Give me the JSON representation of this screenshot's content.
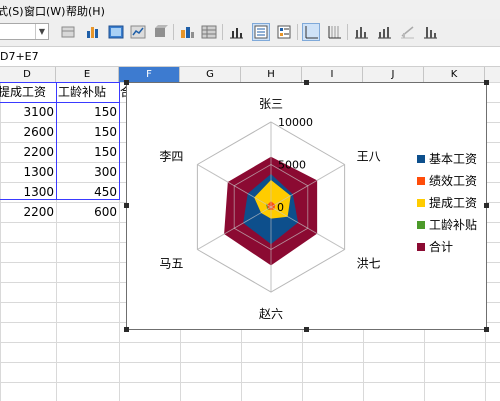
{
  "menu": {
    "items": [
      "式(S)",
      "窗口(W)",
      "帮助(H)"
    ]
  },
  "toolbar": {
    "namebox_value": "",
    "icons": [
      "table-icon",
      "bar-chart-icon",
      "chart-wall-icon",
      "chart-area-icon",
      "3d-view-icon",
      "chart-type-icon",
      "data-table-icon",
      "x-axis-grid-icon",
      "legend-on-off-icon",
      "legend-icon",
      "horizontal-grid-icon",
      "vertical-grid-icon",
      "bar-chart-small-icon",
      "bar-chart-alt-icon",
      "trend-icon",
      "column-chart-icon"
    ]
  },
  "formula_bar": {
    "text": "D7+E7"
  },
  "columns": [
    "D",
    "E",
    "F",
    "G",
    "H",
    "I",
    "J",
    "K"
  ],
  "selected_column": "F",
  "table": {
    "headers": [
      "提成工资",
      "工龄补贴",
      "合"
    ],
    "rows": [
      {
        "d": "3100",
        "e": "150"
      },
      {
        "d": "2600",
        "e": "150"
      },
      {
        "d": "2200",
        "e": "150"
      },
      {
        "d": "1300",
        "e": "300"
      },
      {
        "d": "1300",
        "e": "450"
      },
      {
        "d": "2200",
        "e": "600"
      }
    ]
  },
  "chart_data": {
    "type": "radar",
    "categories": [
      "张三",
      "王八",
      "洪七",
      "赵六",
      "马五",
      "李四"
    ],
    "axis_ticks": [
      "10000",
      "5000",
      "0"
    ],
    "rmax": 10000,
    "series": [
      {
        "name": "合计",
        "color": "#8b0a32",
        "values": [
          5850,
          6200,
          6200,
          6800,
          6300,
          5800
        ]
      },
      {
        "name": "基本工资",
        "color": "#0d4f8c",
        "values": [
          3800,
          2900,
          3600,
          4300,
          3700,
          3100
        ]
      },
      {
        "name": "提成工资",
        "color": "#ffcc00",
        "values": [
          3100,
          2600,
          2200,
          1300,
          1300,
          2200
        ]
      },
      {
        "name": "工龄补贴",
        "color": "#4c9a2a",
        "values": [
          150,
          150,
          150,
          300,
          450,
          600
        ]
      },
      {
        "name": "绩效工资",
        "color": "#ff4d0a",
        "values": [
          600,
          500,
          400,
          300,
          350,
          450
        ]
      }
    ],
    "legend": [
      {
        "name": "基本工资",
        "color": "#0d4f8c"
      },
      {
        "name": "绩效工资",
        "color": "#ff4d0a"
      },
      {
        "name": "提成工资",
        "color": "#ffcc00"
      },
      {
        "name": "工龄补贴",
        "color": "#4c9a2a"
      },
      {
        "name": "合计",
        "color": "#8b0a32"
      }
    ],
    "legend_position": "right"
  }
}
